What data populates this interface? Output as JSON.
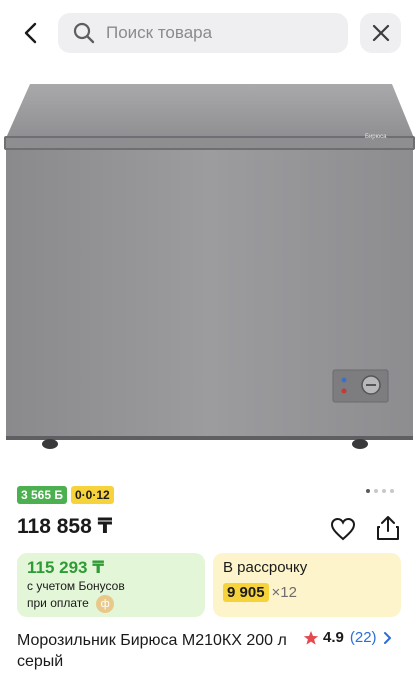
{
  "header": {
    "search_placeholder": "Поиск товара",
    "back_icon": "chevron-left-icon",
    "search_icon": "search-icon",
    "close_icon": "close-icon"
  },
  "product": {
    "image_brand_label": "Бирюса",
    "badge_bonus": "3 565 Б",
    "badge_installment": "0·0·12",
    "price": "118 858 ₸",
    "gallery_total": 4,
    "gallery_active": 1,
    "name": "Морозильник Бирюса М210КХ 200 л серый",
    "rating": "4.9",
    "reviews": "(22)"
  },
  "bonus_card": {
    "price": "115 293 ₸",
    "note_line1": "с учетом Бонусов",
    "note_line2": "при оплате",
    "coin_symbol": "ф"
  },
  "installment_card": {
    "title": "В рассрочку",
    "monthly": "9 905",
    "months": "×12"
  },
  "colors": {
    "accent_green": "#2e9b36",
    "bonus_bg": "#e3f6d7",
    "installment_bg": "#fdf4cc",
    "installment_yellow": "#f6d33b",
    "link_blue": "#2a6ed6",
    "star_red": "#e5484d"
  }
}
